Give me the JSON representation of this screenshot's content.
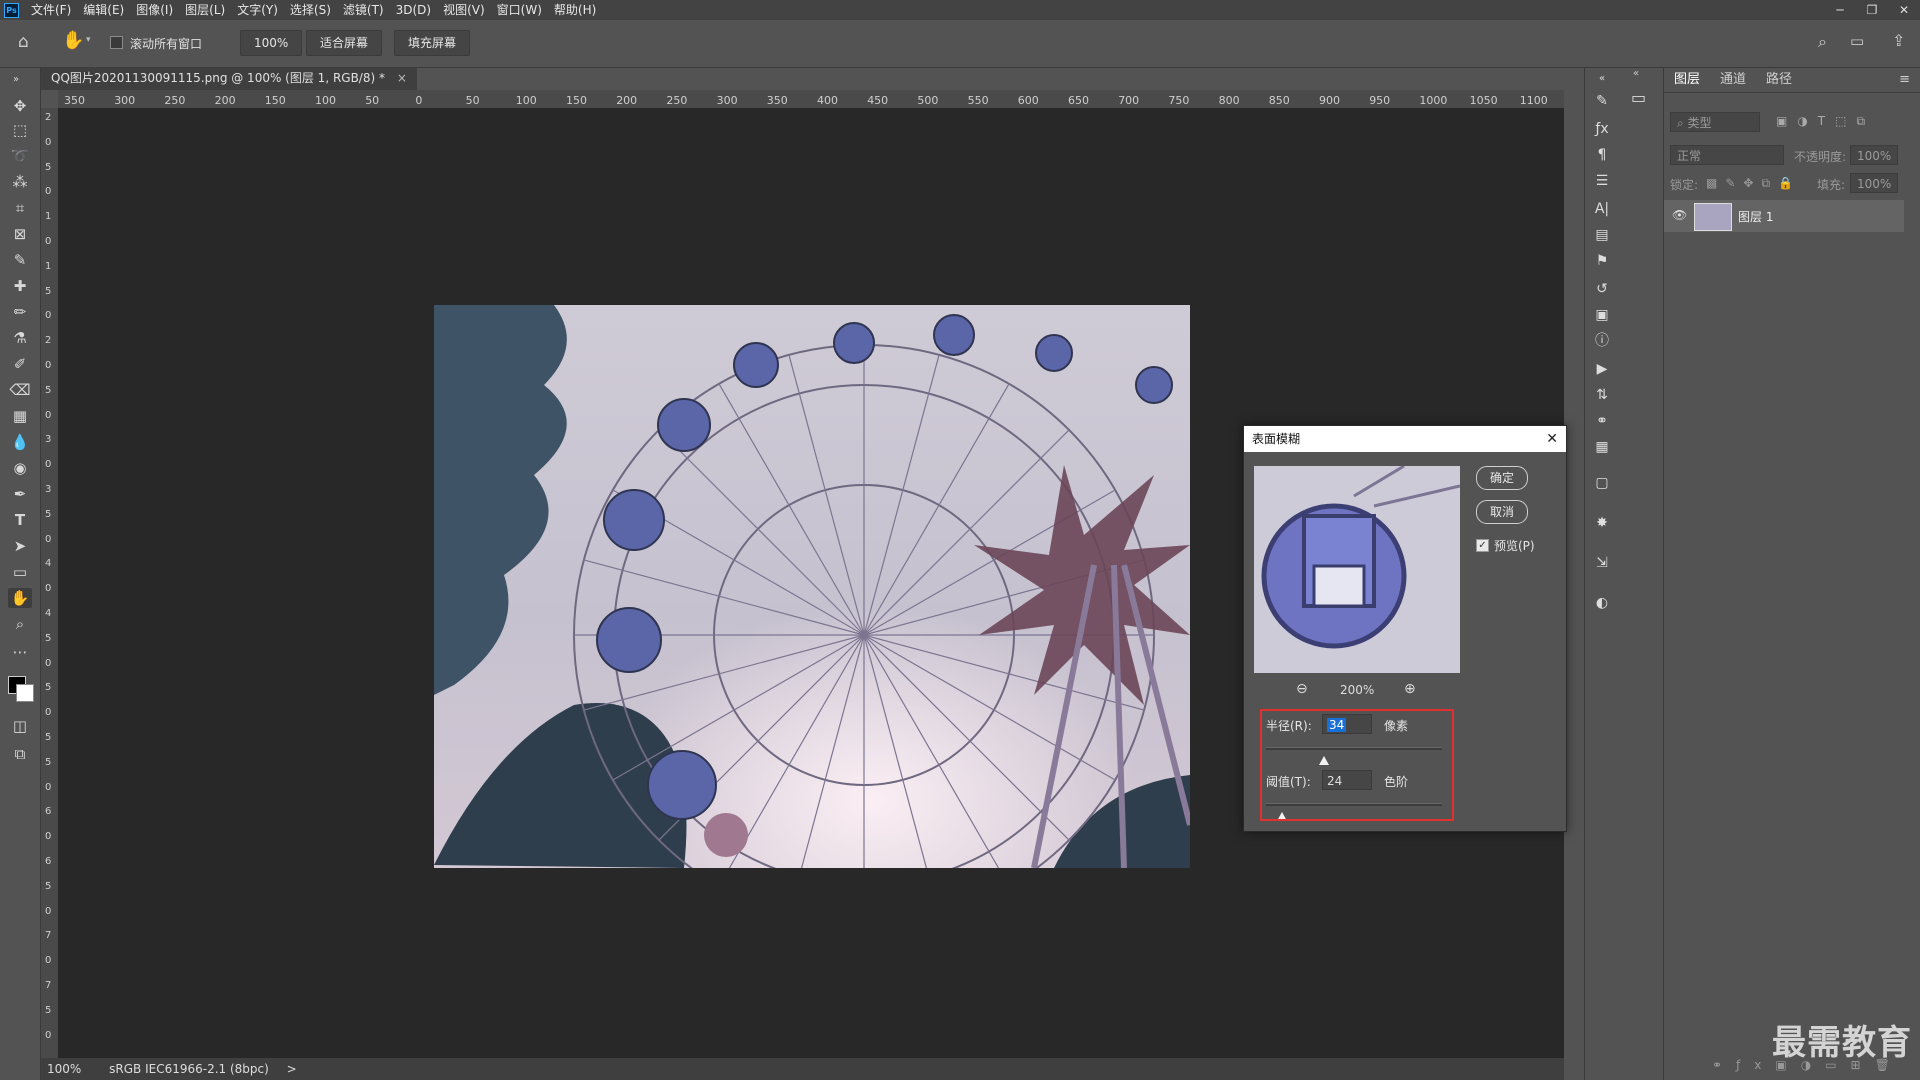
{
  "menubar": {
    "items": [
      "文件(F)",
      "编辑(E)",
      "图像(I)",
      "图层(L)",
      "文字(Y)",
      "选择(S)",
      "滤镜(T)",
      "3D(D)",
      "视图(V)",
      "窗口(W)",
      "帮助(H)"
    ]
  },
  "options": {
    "scroll_all_label": "滚动所有窗口",
    "zoom_value": "100%",
    "fit_screen": "适合屏幕",
    "fill_screen": "填充屏幕"
  },
  "document": {
    "tab_title": "QQ图片20201130091115.png @ 100% (图层 1, RGB/8) *",
    "ruler_h": [
      "350",
      "300",
      "250",
      "200",
      "150",
      "100",
      "50",
      "0",
      "50",
      "100",
      "150",
      "200",
      "250",
      "300",
      "350",
      "400",
      "450",
      "500",
      "550",
      "600",
      "650",
      "700",
      "750",
      "800",
      "850",
      "900",
      "950",
      "1000",
      "1050",
      "1100"
    ],
    "ruler_v": [
      "2",
      "0",
      "5",
      "0",
      "1",
      "0",
      "1",
      "5",
      "0",
      "2",
      "0",
      "5",
      "0",
      "3",
      "0",
      "3",
      "5",
      "0",
      "4",
      "0",
      "4",
      "5",
      "0",
      "5",
      "0",
      "5",
      "5",
      "0",
      "6",
      "0",
      "6",
      "5",
      "0",
      "7",
      "0",
      "7",
      "5",
      "0"
    ]
  },
  "status": {
    "zoom": "100%",
    "profile": "sRGB IEC61966-2.1 (8bpc)",
    "arrow": ">"
  },
  "layers_panel": {
    "tabs": [
      "图层",
      "通道",
      "路径"
    ],
    "filter_placeholder": "类型",
    "blend_mode": "正常",
    "opacity_label": "不透明度:",
    "opacity_value": "100%",
    "lock_label": "锁定:",
    "fill_label": "填充:",
    "fill_value": "100%",
    "layer_name": "图层 1"
  },
  "dialog": {
    "title": "表面模糊",
    "ok": "确定",
    "cancel": "取消",
    "preview_label": "预览(P)",
    "preview_checked": true,
    "zoom": "200%",
    "radius_label": "半径(R):",
    "radius_value": "34",
    "radius_unit": "像素",
    "radius_fraction": 0.33,
    "threshold_label": "阈值(T):",
    "threshold_value": "24",
    "threshold_unit": "色阶",
    "threshold_fraction": 0.09
  },
  "watermark": "最需教育",
  "colors": {
    "accent_red": "#e03030",
    "selection_blue": "#1a6fd6"
  }
}
